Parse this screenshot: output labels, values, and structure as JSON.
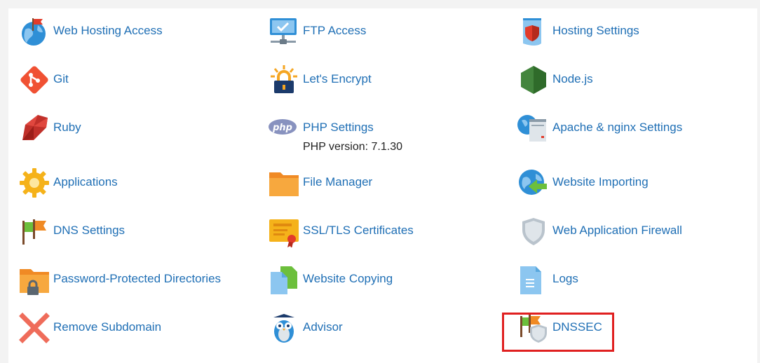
{
  "tools": {
    "web_hosting_access": {
      "label": "Web Hosting Access",
      "icon": "globe-flag-icon"
    },
    "ftp_access": {
      "label": "FTP Access",
      "icon": "monitor-network-icon"
    },
    "hosting_settings": {
      "label": "Hosting Settings",
      "icon": "shield-document-icon"
    },
    "git": {
      "label": "Git",
      "icon": "git-icon"
    },
    "lets_encrypt": {
      "label": "Let's Encrypt",
      "icon": "padlock-sunrise-icon"
    },
    "nodejs": {
      "label": "Node.js",
      "icon": "nodejs-hexagon-icon"
    },
    "ruby": {
      "label": "Ruby",
      "icon": "ruby-gem-icon"
    },
    "php_settings": {
      "label": "PHP Settings",
      "sub": "PHP version: 7.1.30",
      "icon": "php-icon"
    },
    "apache_nginx": {
      "label": "Apache & nginx Settings",
      "icon": "server-globe-icon"
    },
    "applications": {
      "label": "Applications",
      "icon": "gear-icon"
    },
    "file_manager": {
      "label": "File Manager",
      "icon": "folder-icon"
    },
    "website_importing": {
      "label": "Website Importing",
      "icon": "globe-import-icon"
    },
    "dns_settings": {
      "label": "DNS Settings",
      "icon": "flags-icon"
    },
    "ssl_tls": {
      "label": "SSL/TLS Certificates",
      "icon": "certificate-icon"
    },
    "waf": {
      "label": "Web Application Firewall",
      "icon": "shield-icon"
    },
    "password_dirs": {
      "label": "Password-Protected Directories",
      "icon": "locked-folder-icon"
    },
    "website_copying": {
      "label": "Website Copying",
      "icon": "copy-documents-icon"
    },
    "logs": {
      "label": "Logs",
      "icon": "log-document-icon"
    },
    "remove_subdomain": {
      "label": "Remove Subdomain",
      "icon": "remove-x-icon"
    },
    "advisor": {
      "label": "Advisor",
      "icon": "owl-icon"
    },
    "dnssec": {
      "label": "DNSSEC",
      "icon": "flags-shield-icon"
    }
  },
  "colors": {
    "link": "#1f6fb5",
    "highlight_border": "#e02020"
  }
}
